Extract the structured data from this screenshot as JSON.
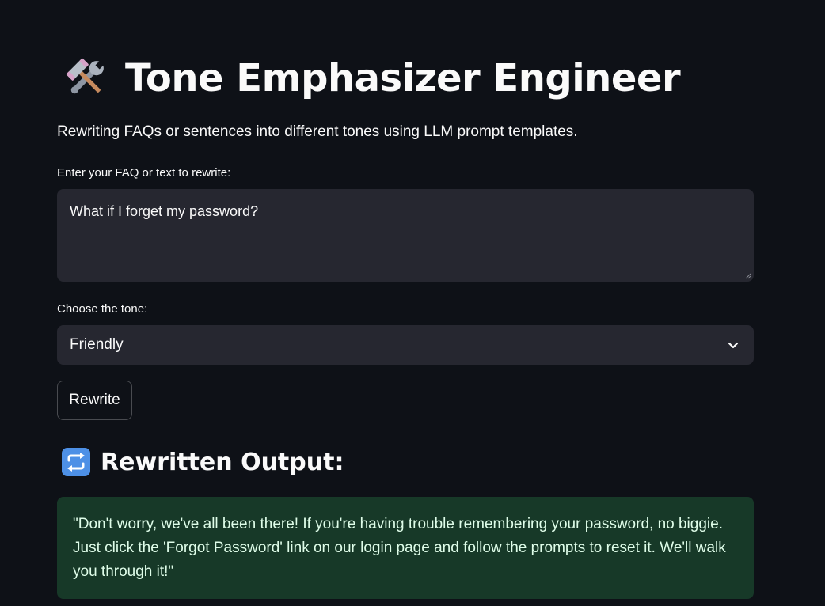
{
  "header": {
    "icon": "hammer-and-wrench-icon",
    "title": "Tone Emphasizer Engineer",
    "subtitle": "Rewriting FAQs or sentences into different tones using LLM prompt templates."
  },
  "form": {
    "text_label": "Enter your FAQ or text to rewrite:",
    "text_value": "What if I forget my password?",
    "tone_label": "Choose the tone:",
    "tone_value": "Friendly",
    "rewrite_label": "Rewrite"
  },
  "output": {
    "icon": "repeat-icon",
    "title": "Rewritten Output:",
    "text": "\"Don't worry, we've all been there! If you're having trouble remembering your password, no biggie. Just click the 'Forgot Password' link on our login page and follow the prompts to reset it. We'll walk you through it!\""
  },
  "colors": {
    "background": "#0e1117",
    "input_background": "#262730",
    "success_background": "#173928",
    "success_text": "#dffde9"
  }
}
